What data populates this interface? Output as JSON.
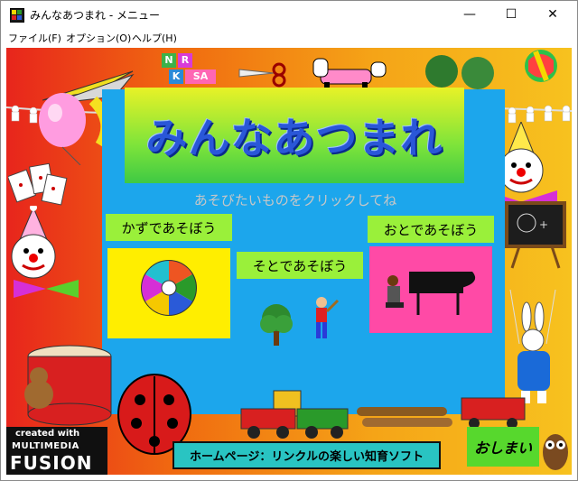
{
  "window": {
    "title": "みんなあつまれ - メニュー"
  },
  "caption_buttons": {
    "minimize": "—",
    "maximize": "☐",
    "close": "✕"
  },
  "menu": [
    "ファイル(F)",
    "オプション(O)",
    "ヘルプ(H)"
  ],
  "banner": {
    "title": "みんなあつまれ"
  },
  "subtitle": "あそびたいものをクリックしてね",
  "cards": {
    "numbers": {
      "label": "かずであそぼう"
    },
    "outside": {
      "label": "そとであそぼう"
    },
    "sound": {
      "label": "おとであそぼう"
    }
  },
  "homepage_button": "ホームページ：リンクルの楽しい知育ソフト",
  "exit_button": "おしまい",
  "badge": {
    "line1": "created with",
    "line2": "MULTIMEDIA",
    "line3": "FUSION"
  },
  "blocks": [
    "N",
    "R",
    "K",
    "SA"
  ],
  "colors": {
    "stage": "#1ca6ec",
    "label_bg": "#9af03a",
    "numbers_card": "#ffee00",
    "sound_card": "#ff4aa6",
    "footer": "#29c4c2"
  },
  "icons": [
    "roulette-icon",
    "tree-icon",
    "boy-icon",
    "piano-icon",
    "clown-icon",
    "balloon-icon",
    "kite-icon",
    "drum-icon",
    "ladybug-icon",
    "train-icon",
    "owl-icon",
    "horse-icon",
    "blackboard-icon",
    "rabbit-puppet-icon"
  ]
}
